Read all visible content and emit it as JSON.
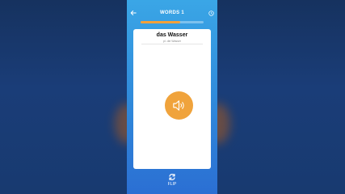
{
  "header": {
    "title": "WORDS 1",
    "back_icon": "arrow-left-icon",
    "timer_icon": "clock-icon"
  },
  "progress": {
    "fraction": 0.63
  },
  "card": {
    "word": "das Wasser",
    "plural": "pl. die Wasser",
    "audio_icon": "speaker-icon"
  },
  "flip": {
    "label": "FLIP",
    "icon": "flip-icon"
  },
  "colors": {
    "accent": "#f0a33c",
    "phone_top": "#3aa6e6",
    "phone_bottom": "#2b6fd3",
    "card": "#ffffff"
  }
}
